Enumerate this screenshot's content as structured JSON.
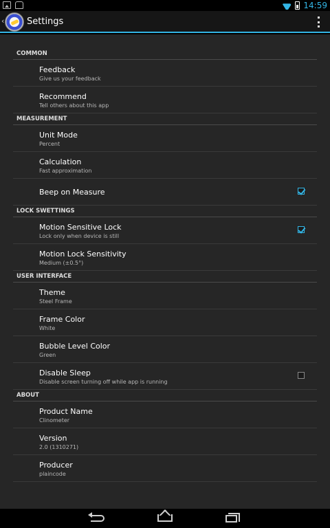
{
  "status_bar": {
    "time": "14:59",
    "icons": [
      "image-notification-icon",
      "android-notification-icon",
      "wifi-icon",
      "battery-icon"
    ]
  },
  "action_bar": {
    "title": "Settings",
    "icons": [
      "up-caret-icon",
      "app-logo-icon",
      "overflow-menu-icon"
    ]
  },
  "sections": [
    {
      "header": "COMMON",
      "items": [
        {
          "title": "Feedback",
          "summary": "Give us your feedback"
        },
        {
          "title": "Recommend",
          "summary": "Tell others about this app"
        }
      ]
    },
    {
      "header": "MEASUREMENT",
      "items": [
        {
          "title": "Unit Mode",
          "summary": "Percent"
        },
        {
          "title": "Calculation",
          "summary": "Fast approximation"
        },
        {
          "title": "Beep on Measure",
          "summary": "",
          "checkbox": true,
          "checked": true
        }
      ]
    },
    {
      "header": "LOCK SWETTINGS",
      "items": [
        {
          "title": "Motion Sensitive Lock",
          "summary": "Lock only when device is still",
          "checkbox": true,
          "checked": true
        },
        {
          "title": "Motion Lock Sensitivity",
          "summary": "Medium (±0.5°)"
        }
      ]
    },
    {
      "header": "USER INTERFACE",
      "items": [
        {
          "title": "Theme",
          "summary": "Steel Frame"
        },
        {
          "title": "Frame Color",
          "summary": "White"
        },
        {
          "title": "Bubble Level Color",
          "summary": "Green"
        },
        {
          "title": "Disable Sleep",
          "summary": "Disable screen turning off while app is running",
          "checkbox": true,
          "checked": false
        }
      ]
    },
    {
      "header": "ABOUT",
      "items": [
        {
          "title": "Product Name",
          "summary": "Clinometer"
        },
        {
          "title": "Version",
          "summary": "2.0 (1310271)"
        },
        {
          "title": "Producer",
          "summary": "plaincode"
        }
      ]
    }
  ],
  "nav_bar": {
    "icons": [
      "back-icon",
      "home-icon",
      "recent-apps-icon"
    ]
  },
  "colors": {
    "accent": "#33b5e5",
    "background": "#262626",
    "action_bar": "#161616"
  }
}
